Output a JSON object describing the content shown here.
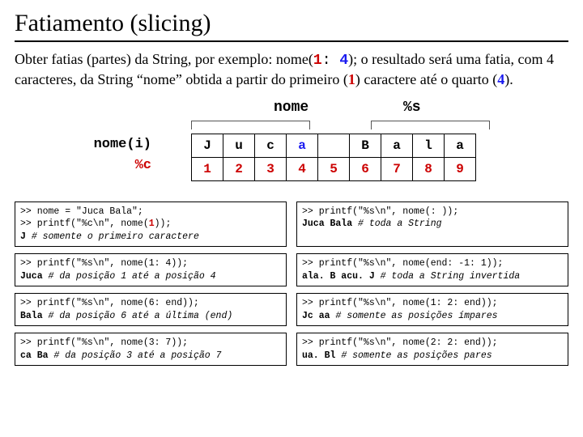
{
  "title": "Fatiamento (slicing)",
  "intro": {
    "p1a": "Obter fatias (partes) da String, por exemplo: nome(",
    "p1_one": "1",
    "p1_colon": ": ",
    "p1_four": "4",
    "p1b": "); o resultado será uma fatia, com 4 caracteres, da String “nome” obtida a partir do primeiro (",
    "p1_one2": "1",
    "p1c": ") caractere até o quarto (",
    "p1_four2": "4",
    "p1d": ")."
  },
  "diagram": {
    "nome": "nome",
    "pct_s": "%s",
    "row_top": "nome(i)",
    "row_bot": "%c",
    "letters": [
      "J",
      "u",
      "c",
      "a",
      "",
      "B",
      "a",
      "l",
      "a"
    ],
    "indices": [
      "1",
      "2",
      "3",
      "4",
      "5",
      "6",
      "7",
      "8",
      "9"
    ]
  },
  "boxes": {
    "l1": ">> nome = \"Juca Bala\";\n>> printf(\"%c\\n\", nome(1));\nJ # somente o primeiro caractere",
    "r1": ">> printf(\"%s\\n\", nome(: ));\nJuca Bala # toda a String",
    "l2": ">> printf(\"%s\\n\", nome(1: 4));\nJuca # da posição 1 até a posição 4",
    "r2": ">> printf(\"%s\\n\", nome(end: -1: 1));\nala. B acu. J # toda a String invertida",
    "l3": ">> printf(\"%s\\n\", nome(6: end));\nBala # da posição 6 até a última (end)",
    "r3": ">> printf(\"%s\\n\", nome(1: 2: end));\nJc aa # somente as posições ímpares",
    "l4": ">> printf(\"%s\\n\", nome(3: 7));\nca Ba # da posição 3 até a posição 7",
    "r4": ">> printf(\"%s\\n\", nome(2: 2: end));\nua. Bl # somente as posições pares"
  }
}
